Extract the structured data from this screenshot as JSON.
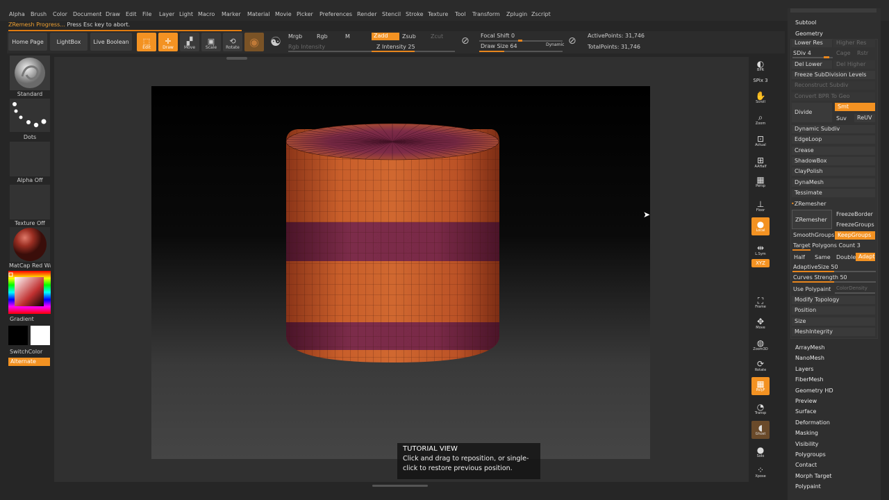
{
  "menu": [
    "Alpha",
    "Brush",
    "Color",
    "Document",
    "Draw",
    "Edit",
    "File",
    "Layer",
    "Light",
    "Macro",
    "Marker",
    "Material",
    "Movie",
    "Picker",
    "Preferences",
    "Render",
    "Stencil",
    "Stroke",
    "Texture",
    "Tool",
    "Transform",
    "Zplugin",
    "Zscript"
  ],
  "status": {
    "prefix": "ZRemesh Progress...",
    "message": "Press Esc key to abort."
  },
  "toolbar": {
    "home": "Home Page",
    "lightbox": "LightBox",
    "live_boolean": "Live Boolean",
    "edit": "Edit",
    "draw": "Draw",
    "move": "Move",
    "scale": "Scale",
    "rotate": "Rotate",
    "mrgb": "Mrgb",
    "rgb": "Rgb",
    "m": "M",
    "rgb_intensity": "Rgb Intensity",
    "zadd": "Zadd",
    "zsub": "Zsub",
    "zcut": "Zcut",
    "z_intensity": "Z Intensity 25",
    "focal_shift": "Focal Shift 0",
    "draw_size": "Draw Size 64",
    "dynamic": "Dynamic",
    "active_points": "ActivePoints: 31,746",
    "total_points": "TotalPoints: 31,746"
  },
  "left_panel": {
    "brush": "Standard",
    "stroke": "Dots",
    "alpha": "Alpha Off",
    "texture": "Texture Off",
    "material": "MatCap Red Wax",
    "gradient": "Gradient",
    "switch_color": "SwitchColor",
    "alternate": "Alternate"
  },
  "right_icons": [
    {
      "label": "BPR",
      "icon": "bpr-icon"
    },
    {
      "label": "SPix 3",
      "icon": "spix-slider"
    },
    {
      "label": "Scroll",
      "icon": "scroll-icon"
    },
    {
      "label": "Zoom",
      "icon": "zoom-icon"
    },
    {
      "label": "Actual",
      "icon": "actual-icon"
    },
    {
      "label": "AAHalf",
      "icon": "aahalf-icon"
    },
    {
      "label": "Persp",
      "icon": "persp-icon"
    },
    {
      "label": "Floor",
      "icon": "floor-icon"
    },
    {
      "label": "Local",
      "icon": "local-icon"
    },
    {
      "label": "L.Sym",
      "icon": "lsym-icon"
    },
    {
      "label": "XYZ",
      "icon": "xyz-icon"
    },
    {
      "label": "Frame",
      "icon": "frame-icon"
    },
    {
      "label": "Move",
      "icon": "move-icon"
    },
    {
      "label": "Zoom3D",
      "icon": "zoom3d-icon"
    },
    {
      "label": "Rotate",
      "icon": "rotate-icon"
    },
    {
      "label": "PolyF",
      "icon": "polyf-icon"
    },
    {
      "label": "Transp",
      "icon": "transp-icon"
    },
    {
      "label": "Ghost",
      "icon": "ghost-icon"
    },
    {
      "label": "Solo",
      "icon": "solo-icon"
    },
    {
      "label": "Xpose",
      "icon": "xpose-icon"
    }
  ],
  "right_panel": {
    "subtool": "Subtool",
    "geometry": "Geometry",
    "lower_res": "Lower Res",
    "higher_res": "Higher Res",
    "sdiv": "SDiv 4",
    "cage": "Cage",
    "rstr": "Rstr",
    "del_lower": "Del Lower",
    "del_higher": "Del Higher",
    "freeze_subdiv": "Freeze SubDivision Levels",
    "reconstruct": "Reconstruct Subdiv",
    "convert_bpr": "Convert BPR To Geo",
    "divide": "Divide",
    "smt": "Smt",
    "suv": "Suv",
    "reuv": "ReUV",
    "items": [
      "Dynamic Subdiv",
      "EdgeLoop",
      "Crease",
      "ShadowBox",
      "ClayPolish",
      "DynaMesh",
      "Tessimate"
    ],
    "zremesher_header": "ZRemesher",
    "zremesher_btn": "ZRemesher",
    "freeze_border": "FreezeBorder",
    "freeze_groups": "FreezeGroups",
    "smooth_groups": "SmoothGroups",
    "keep_groups": "KeepGroups",
    "target_polys": "Target Polygons Count 3",
    "half": "Half",
    "same": "Same",
    "double": "Double",
    "adapt": "Adapt",
    "adaptive_size": "AdaptiveSize 50",
    "curves_strength": "Curves Strength 50",
    "use_polypaint": "Use Polypaint",
    "color_density": "ColorDensity",
    "modify_topology": "Modify Topology",
    "position": "Position",
    "size": "Size",
    "mesh_integrity": "MeshIntegrity",
    "sections": [
      "ArrayMesh",
      "NanoMesh",
      "Layers",
      "FiberMesh",
      "Geometry HD",
      "Preview",
      "Surface",
      "Deformation",
      "Masking",
      "Visibility",
      "Polygroups",
      "Contact",
      "Morph Target",
      "Polypaint"
    ]
  },
  "tutorial": {
    "title": "TUTORIAL VIEW",
    "text": "Click and drag to reposition, or single-click to restore previous position."
  },
  "colors": {
    "accent": "#f39222",
    "model_orange": "#c0562a",
    "model_band": "#7a2a48"
  }
}
